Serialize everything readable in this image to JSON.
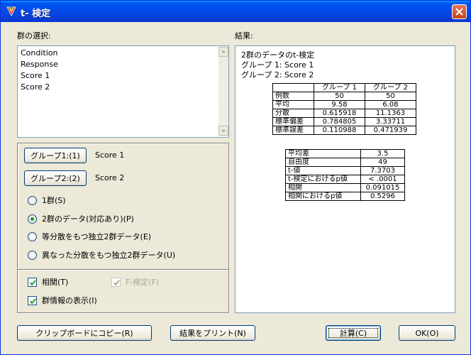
{
  "window": {
    "title": "t- 検定",
    "title_bar_color": "#0a3ad1"
  },
  "left": {
    "group_select_label": "群の選択:",
    "variables": [
      "Condition",
      "Response",
      "Score 1",
      "Score 2"
    ],
    "group1_button": "グループ1:(1)",
    "group1_value": "Score 1",
    "group2_button": "グループ2:(2)",
    "group2_value": "Score 2",
    "radio_options": [
      {
        "label": "1群(S)",
        "selected": false
      },
      {
        "label": "2群のデータ(対応あり)(P)",
        "selected": true
      },
      {
        "label": "等分散をもつ独立2群データ(E)",
        "selected": false
      },
      {
        "label": "異なった分散をもつ独立2群データ(U)",
        "selected": false
      }
    ],
    "correlation_checkbox": {
      "label": "相関(T)",
      "checked": true
    },
    "ftest_checkbox": {
      "label": "F-検定(F)",
      "checked": true,
      "enabled": false
    },
    "show_group_info_checkbox": {
      "label": "群情報の表示(I)",
      "checked": true
    }
  },
  "right": {
    "results_label": "結果:",
    "header_lines": [
      "2群のデータのt-検定",
      "グループ 1:  Score 1",
      "グループ 2:  Score 2"
    ],
    "group_table": {
      "columns": [
        "",
        "グループ 1",
        "グループ 2"
      ],
      "rows": [
        [
          "例数",
          "50",
          "50"
        ],
        [
          "平均",
          "9.58",
          "6.08"
        ],
        [
          "分散",
          "0.615918",
          "11.1363"
        ],
        [
          "標準偏差",
          "0.784805",
          "3.33711"
        ],
        [
          "標準誤差",
          "0.110988",
          "0.471939"
        ]
      ]
    },
    "stats_table": {
      "rows": [
        [
          "平均差",
          "3.5"
        ],
        [
          "自由度",
          "49"
        ],
        [
          "t-値",
          "7.3703"
        ],
        [
          "t-検定におけるp値",
          "< .0001"
        ],
        [
          "相関",
          "0.091015"
        ],
        [
          "相関におけるp値",
          "0.5296"
        ]
      ]
    }
  },
  "buttons": {
    "copy_clipboard": "クリップボードにコピー(R)",
    "print_results": "結果をプリント(N)",
    "calculate": "計算(C)",
    "ok": "OK(O)"
  }
}
